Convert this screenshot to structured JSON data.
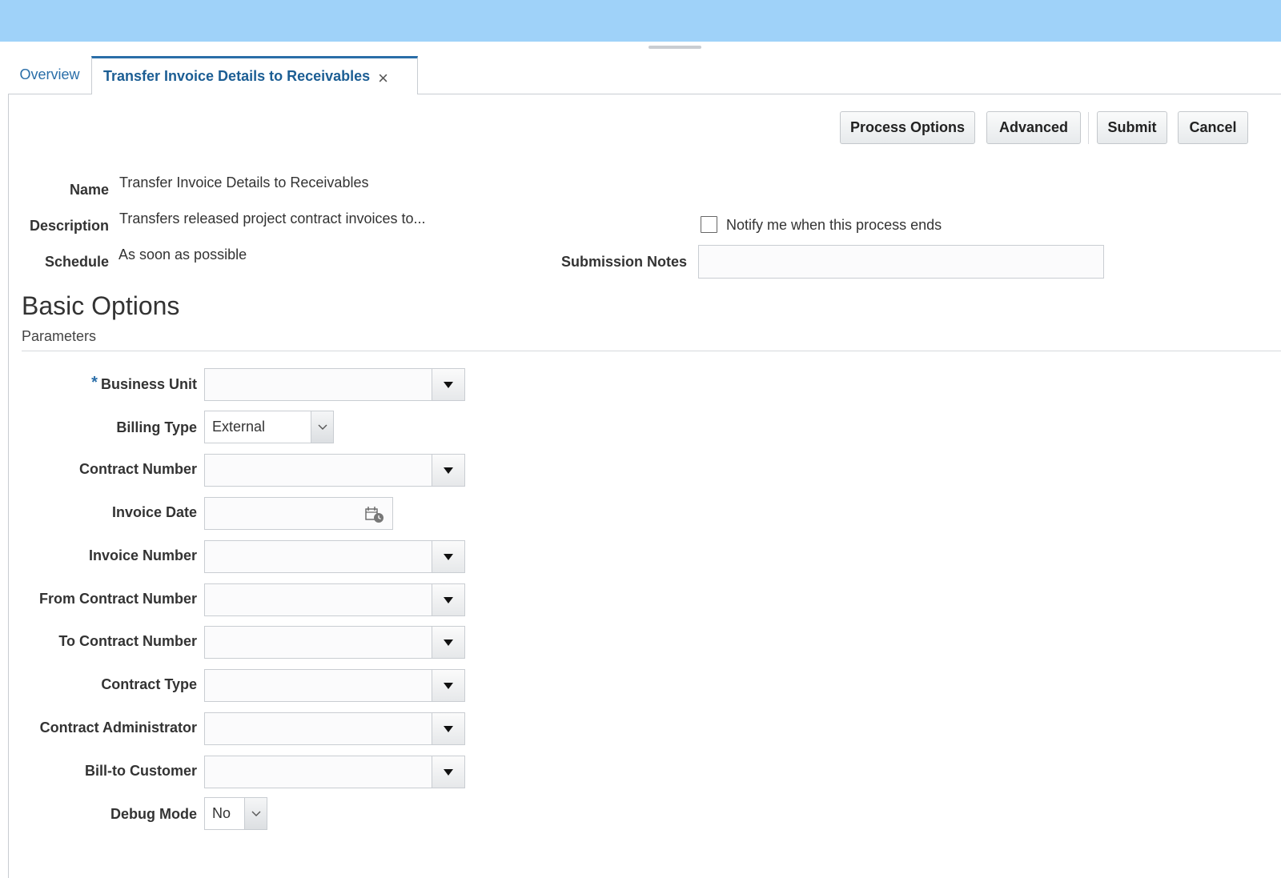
{
  "tabs": {
    "overview": "Overview",
    "active": "Transfer Invoice Details to Receivables",
    "close_glyph": "×"
  },
  "toolbar": {
    "process_options": "Process Options",
    "advanced": "Advanced",
    "submit": "Submit",
    "cancel": "Cancel"
  },
  "header": {
    "name_label": "Name",
    "name_value": "Transfer Invoice Details to Receivables",
    "description_label": "Description",
    "description_value": "Transfers released project contract invoices to...",
    "schedule_label": "Schedule",
    "schedule_value": "As soon as possible",
    "notify_label": "Notify me when this process ends",
    "notify_checked": false,
    "submission_notes_label": "Submission Notes",
    "submission_notes_value": ""
  },
  "section": {
    "title": "Basic Options",
    "subtitle": "Parameters"
  },
  "params": {
    "business_unit": {
      "label": "Business Unit",
      "required": "*",
      "value": ""
    },
    "billing_type": {
      "label": "Billing Type",
      "value": "External"
    },
    "contract_number": {
      "label": "Contract Number",
      "value": ""
    },
    "invoice_date": {
      "label": "Invoice Date",
      "value": ""
    },
    "invoice_number": {
      "label": "Invoice Number",
      "value": ""
    },
    "from_contract_number": {
      "label": "From Contract Number",
      "value": ""
    },
    "to_contract_number": {
      "label": "To Contract Number",
      "value": ""
    },
    "contract_type": {
      "label": "Contract Type",
      "value": ""
    },
    "contract_administrator": {
      "label": "Contract Administrator",
      "value": ""
    },
    "bill_to_customer": {
      "label": "Bill-to Customer",
      "value": ""
    },
    "debug_mode": {
      "label": "Debug Mode",
      "value": "No"
    }
  },
  "colors": {
    "top_band": "#9fd2f9",
    "accent": "#2a6ea8"
  }
}
